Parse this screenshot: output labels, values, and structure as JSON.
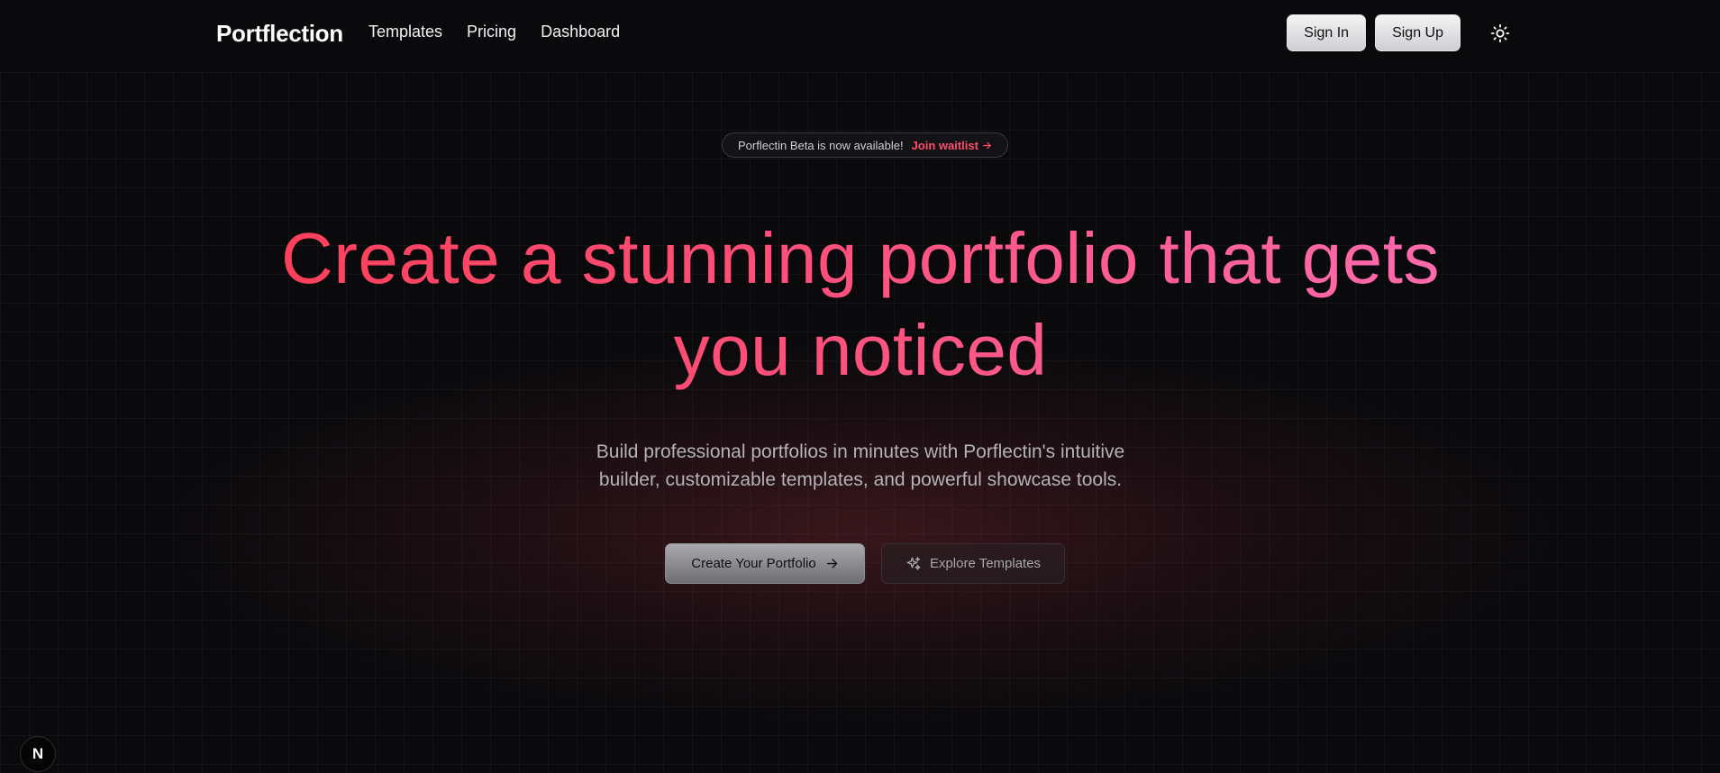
{
  "nav": {
    "brand": "Portflection",
    "links": [
      "Templates",
      "Pricing",
      "Dashboard"
    ],
    "sign_in": "Sign In",
    "sign_up": "Sign Up",
    "theme_icon": "sun-icon"
  },
  "hero": {
    "badge_text": "Porflectin Beta is now available!",
    "badge_link": "Join waitlist",
    "headline_line1": "Create a stunning portfolio that gets",
    "headline_line2": "you noticed",
    "subhead_line1": "Build professional portfolios in minutes with Porflectin's intuitive",
    "subhead_line2": "builder, customizable templates, and powerful showcase tools.",
    "cta_primary": "Create Your Portfolio",
    "cta_secondary": "Explore Templates"
  },
  "dev_badge": "N",
  "colors": {
    "background": "#0a0a0c",
    "accent_start": "#ff3d55",
    "accent_end": "#ff6fb4"
  }
}
